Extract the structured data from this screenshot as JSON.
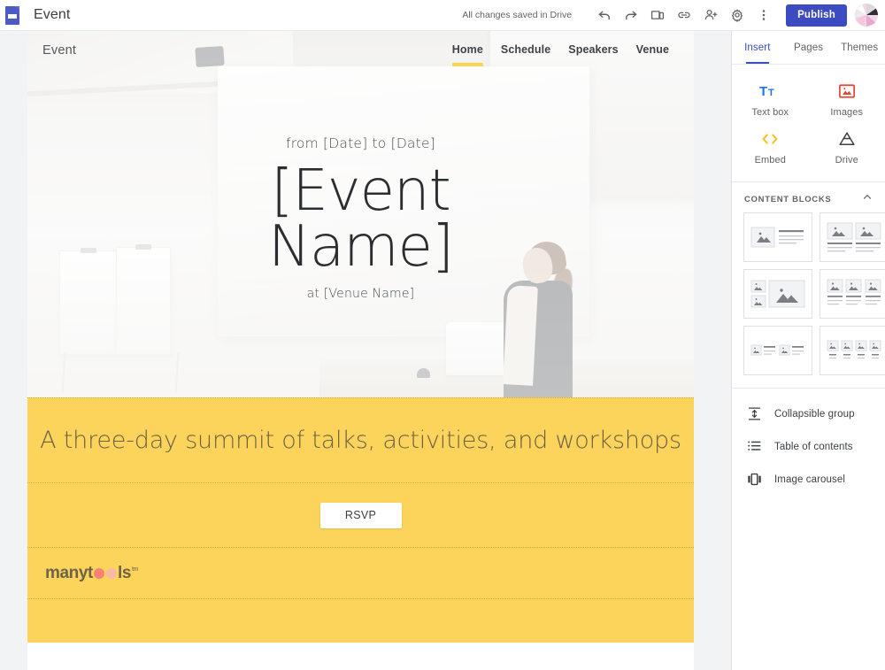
{
  "app": {
    "logo_icon": "google-sites-icon",
    "doc_title": "Event",
    "save_status": "All changes saved in Drive",
    "publish_label": "Publish",
    "toolbar_icons": [
      {
        "name": "undo-icon",
        "title": "Undo"
      },
      {
        "name": "redo-icon",
        "title": "Redo"
      },
      {
        "name": "preview-icon",
        "title": "Preview"
      },
      {
        "name": "copy-link-icon",
        "title": "Copy published site link"
      },
      {
        "name": "add-person-icon",
        "title": "Share with others"
      },
      {
        "name": "settings-gear-icon",
        "title": "Settings"
      },
      {
        "name": "more-vert-icon",
        "title": "More"
      }
    ],
    "avatar_label": "Account"
  },
  "site": {
    "name": "Event",
    "nav": [
      {
        "label": "Home",
        "active": true
      },
      {
        "label": "Schedule",
        "active": false
      },
      {
        "label": "Speakers",
        "active": false
      },
      {
        "label": "Venue",
        "active": false
      }
    ],
    "hero": {
      "dates": "from [Date] to [Date]",
      "title_line_1": "[Event",
      "title_line_2": "Name]",
      "venue": "at [Venue Name]"
    },
    "tagline": "A three-day summit of talks, activities, and workshops",
    "cta_label": "RSVP",
    "footer_logo": {
      "part_1": "manyt",
      "part_2": "ls",
      "trademark": "tm"
    }
  },
  "panel": {
    "tabs": [
      {
        "label": "Insert",
        "active": true
      },
      {
        "label": "Pages",
        "active": false
      },
      {
        "label": "Themes",
        "active": false
      }
    ],
    "insert_items": [
      {
        "label": "Text box",
        "icon": "text-box-icon"
      },
      {
        "label": "Images",
        "icon": "images-icon"
      },
      {
        "label": "Embed",
        "icon": "embed-code-icon"
      },
      {
        "label": "Drive",
        "icon": "google-drive-icon"
      }
    ],
    "content_blocks_title": "CONTENT BLOCKS",
    "content_blocks_collapse_icon": "chevron-up-icon",
    "content_blocks": [
      {
        "name": "image-left-text-right-block"
      },
      {
        "name": "two-image-columns-block"
      },
      {
        "name": "two-small-left-one-large-right-block"
      },
      {
        "name": "three-image-columns-block"
      },
      {
        "name": "two-image-text-pairs-block"
      },
      {
        "name": "four-image-columns-block"
      }
    ],
    "list_items": [
      {
        "label": "Collapsible group",
        "icon": "collapsible-group-icon"
      },
      {
        "label": "Table of contents",
        "icon": "table-of-contents-icon"
      },
      {
        "label": "Image carousel",
        "icon": "image-carousel-icon"
      }
    ]
  },
  "colors": {
    "brand_indigo": "#3c4cc0",
    "site_yellow": "#fcd45c",
    "nav_underline": "#fcd450",
    "logo_coral": "#fa8072",
    "text_primary": "#3c4043",
    "text_secondary": "#5f6368"
  }
}
